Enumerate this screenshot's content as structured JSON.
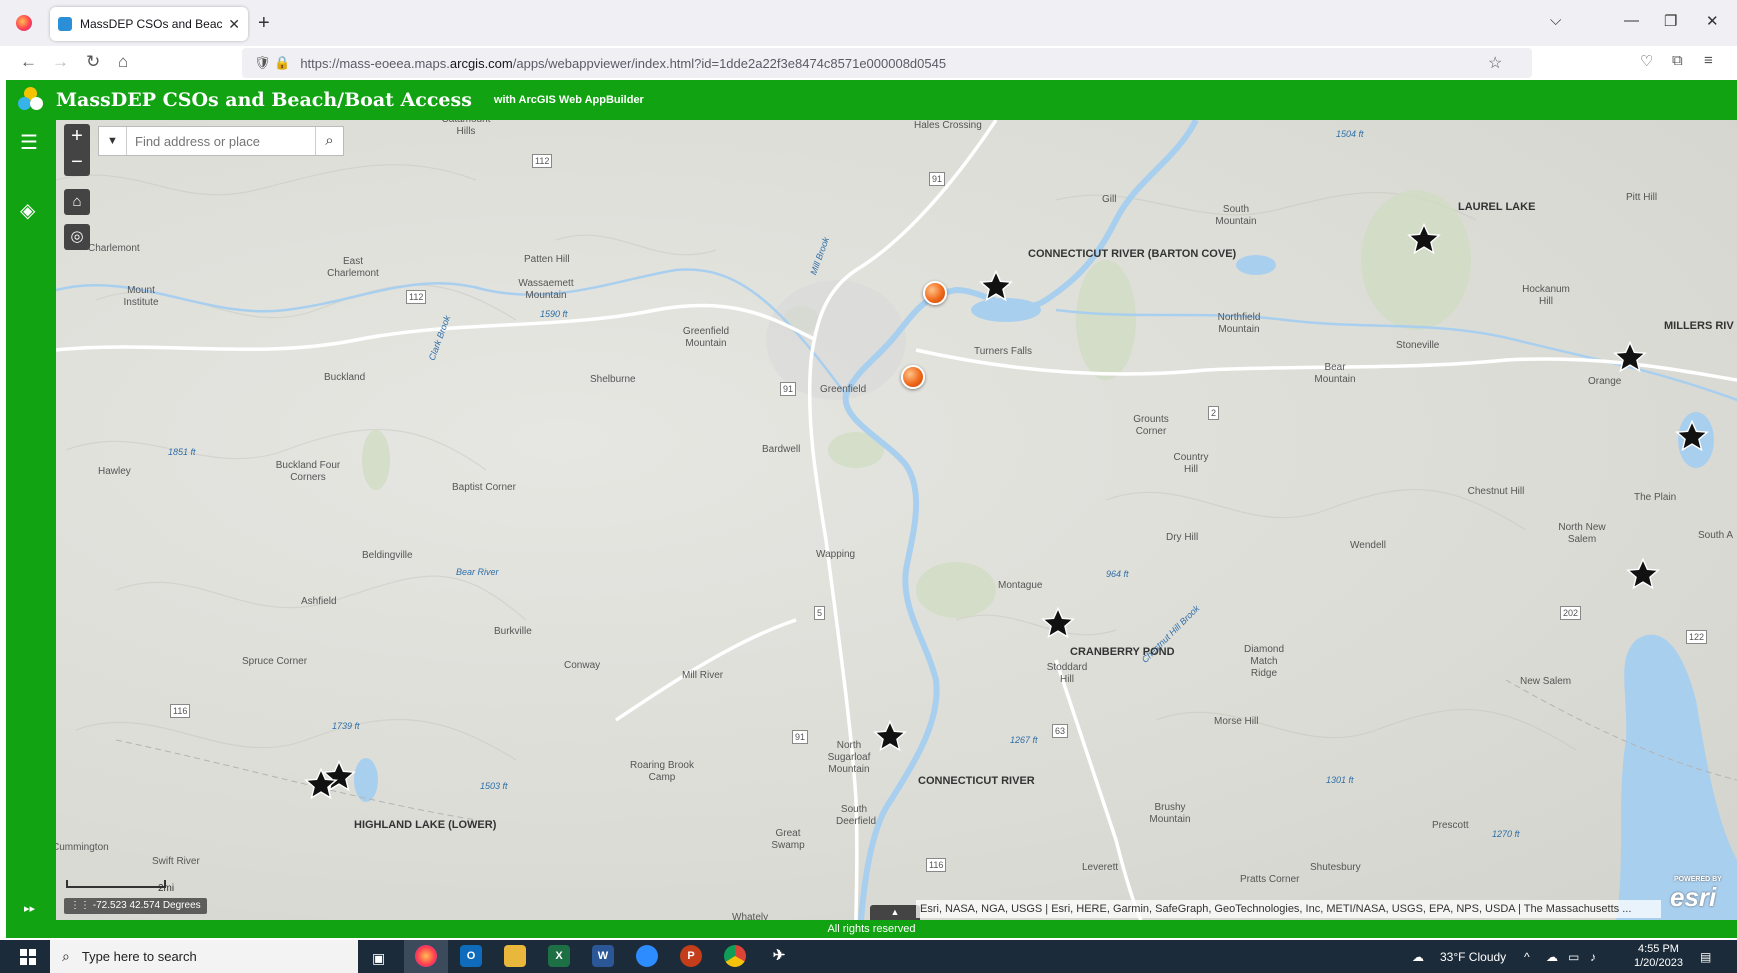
{
  "browser": {
    "tab_title": "MassDEP CSOs and Beach/Boat",
    "url_prefix": "https://mass-eoeea.maps.",
    "url_domain": "arcgis.com",
    "url_suffix": "/apps/webappviewer/index.html?id=1dde2a22f3e8474c8571e000008d0545"
  },
  "app": {
    "title": "MassDEP CSOs and Beach/Boat Access",
    "subtitle": "with ArcGIS Web AppBuilder",
    "footer": "All rights reserved"
  },
  "search": {
    "placeholder": "Find address or place"
  },
  "map": {
    "scale_label": "2mi",
    "coordinates": "-72.523 42.574 Degrees",
    "attribution": "Esri, NASA, NGA, USGS | Esri, HERE, Garmin, SafeGraph, GeoTechnologies, Inc, METI/NASA, USGS, EPA, NPS, USDA | The Massachusetts ...",
    "esri_powered": "POWERED BY",
    "esri_logo": "esri",
    "features": [
      "CONNECTICUT RIVER (BARTON COVE)",
      "LAUREL LAKE",
      "MILLERS RIV",
      "CRANBERRY POND",
      "CONNECTICUT RIVER",
      "HIGHLAND LAKE (LOWER)"
    ],
    "places": [
      "Hales Crossing",
      "Catamount Hills",
      "Charlemont",
      "East Charlemont",
      "Mount Institute",
      "Patten Hill",
      "Wassaemett Mountain",
      "1590 ft",
      "Greenfield Mountain",
      "Turners Falls",
      "Greenfield",
      "Gill",
      "South Mountain",
      "Northfield Mountain",
      "Bear Mountain",
      "Stoneville",
      "Hockanum Hill",
      "Pitt Hill",
      "Orange",
      "Grounts Corner",
      "Country Hill",
      "Buckland",
      "Shelburne",
      "Bardwell",
      "Hawley",
      "1851 ft",
      "Buckland Four Corners",
      "Baptist Corner",
      "Beldingville",
      "Wapping",
      "Dry Hill",
      "Chestnut Hill",
      "The Plain",
      "North New Salem",
      "Wendell",
      "South A",
      "Ashfield",
      "Montague",
      "964 ft",
      "Burkville",
      "Spruce Corner",
      "Conway",
      "Mill River",
      "Stoddard Hill",
      "Diamond Match Ridge",
      "New Salem",
      "1739 ft",
      "Morse Hill",
      "1267 ft",
      "North Sugarloaf Mountain",
      "Roaring Brook Camp",
      "1503 ft",
      "1301 ft",
      "South Deerfield",
      "Great Swamp",
      "Brushy Mountain",
      "Prescott",
      "1270 ft",
      "Cummington",
      "Swift River",
      "Leverett",
      "Shutesbury",
      "Pratts Corner",
      "Whately",
      "1504 ft"
    ],
    "roads": [
      "112",
      "91",
      "112",
      "91",
      "2",
      "5",
      "116",
      "63",
      "116",
      "202",
      "122",
      "91"
    ],
    "water": [
      "Mill Brook",
      "Bear River",
      "Chestnut Hill Brook",
      "Clark Brook"
    ]
  },
  "taskbar": {
    "search_text": "Type here to search",
    "weather": "33°F  Cloudy",
    "time": "4:55 PM",
    "date": "1/20/2023"
  }
}
